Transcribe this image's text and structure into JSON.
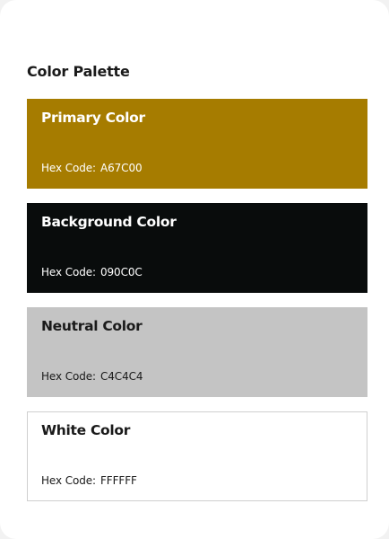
{
  "heading": "Color Palette",
  "swatches": [
    {
      "name": "Primary Color",
      "hex_label": "Hex Code:",
      "hex_value": "A67C00",
      "bg": "#A67C00",
      "text_color": "#ffffff"
    },
    {
      "name": "Background Color",
      "hex_label": "Hex Code:",
      "hex_value": "090C0C",
      "bg": "#090C0C",
      "text_color": "#ffffff"
    },
    {
      "name": "Neutral Color",
      "hex_label": "Hex Code:",
      "hex_value": "C4C4C4",
      "bg": "#C4C4C4",
      "text_color": "#1a1a1a"
    },
    {
      "name": "White Color",
      "hex_label": "Hex Code:",
      "hex_value": "FFFFFF",
      "bg": "#FFFFFF",
      "text_color": "#1a1a1a"
    }
  ]
}
